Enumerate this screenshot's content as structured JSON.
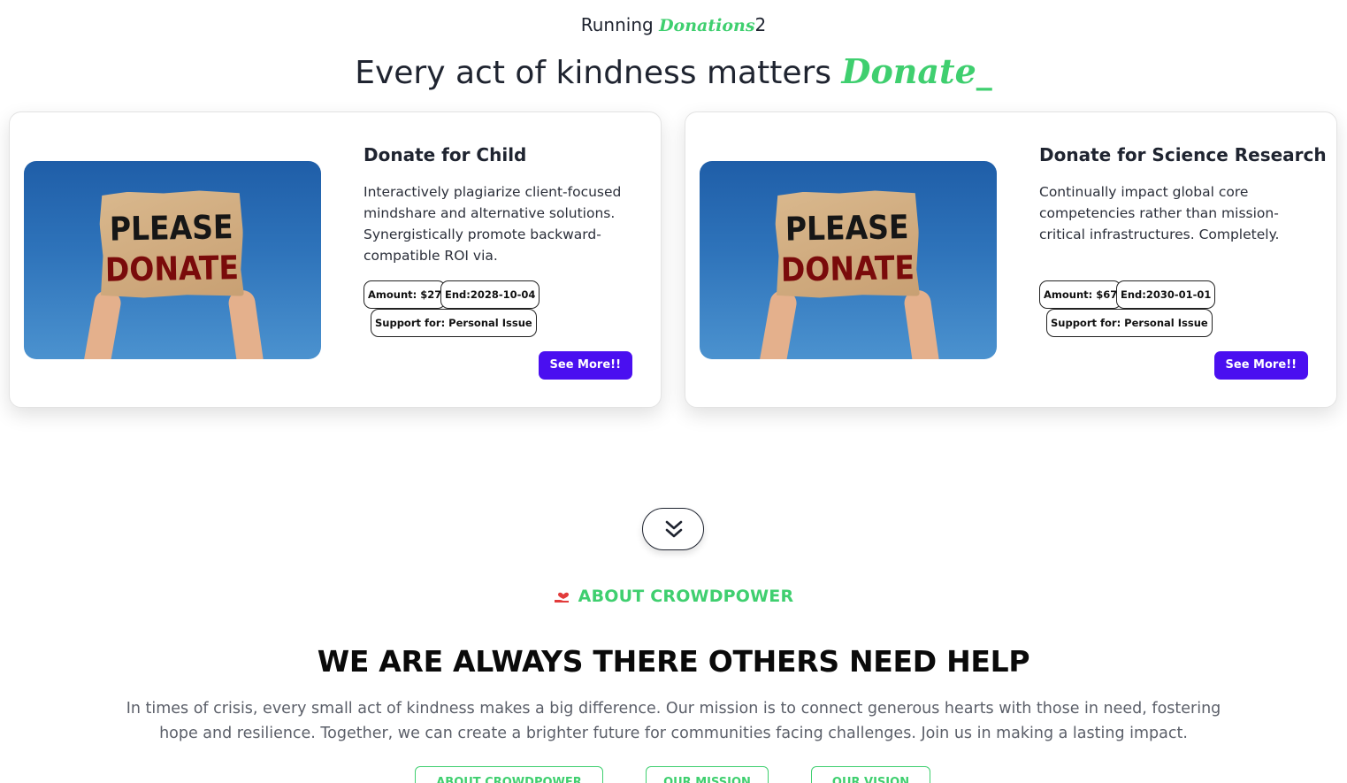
{
  "header": {
    "running_prefix": "Running ",
    "running_script": "Donations",
    "running_count": "2",
    "headline_text": "Every act of kindness matters ",
    "headline_script": "Donate",
    "headline_cursor": "_"
  },
  "cards": [
    {
      "title": "Donate for Child",
      "description": "Interactively plagiarize client-focused mindshare and alternative solutions. Synergistically promote backward-compatible ROI via.",
      "amount": "Amount: $27",
      "end": "End:2028-10-04",
      "support": "Support for: Personal Issue",
      "button": "See More!!",
      "image_sign_line1": "PLEASE",
      "image_sign_line2": "DONATE"
    },
    {
      "title": "Donate for Science Research",
      "description": "Continually impact global core competencies rather than mission-critical infrastructures. Completely.",
      "amount": "Amount: $67",
      "end": "End:2030-01-01",
      "support": "Support for: Personal Issue",
      "button": "See More!!",
      "image_sign_line1": "PLEASE",
      "image_sign_line2": "DONATE"
    }
  ],
  "scroll_icon": "double-chevron-down-icon",
  "about": {
    "tag": "ABOUT CROWDPOWER",
    "tag_icon": "heart-hand-icon",
    "heading": "WE ARE ALWAYS THERE OTHERS NEED HELP",
    "paragraph": "In times of crisis, every small act of kindness makes a big difference. Our mission is to connect generous hearts with those in need, fostering hope and resilience. Together, we can create a brighter future for communities facing challenges. Join us in making a lasting impact.",
    "tabs": [
      "ABOUT CROWDPOWER",
      "OUR MISSION",
      "OUR VISION"
    ]
  },
  "colors": {
    "accent_green": "#3fcf6f",
    "button_purple": "#4a0ff0",
    "text_dark": "#1f2430"
  }
}
